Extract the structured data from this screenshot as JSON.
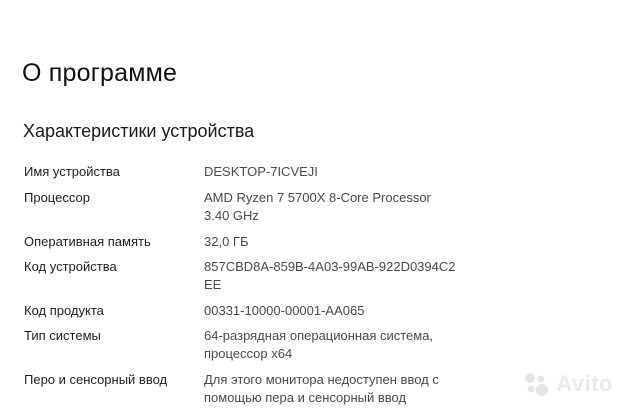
{
  "page": {
    "title": "О программе",
    "section_title": "Характеристики устройства"
  },
  "specs": [
    {
      "label": "Имя устройства",
      "value": [
        "DESKTOP-7ICVEJI"
      ]
    },
    {
      "label": "Процессор",
      "value": [
        "AMD Ryzen 7 5700X 8-Core Processor",
        "3.40 GHz"
      ]
    },
    {
      "label": "Оперативная память",
      "value": [
        "32,0 ГБ"
      ]
    },
    {
      "label": "Код устройства",
      "value": [
        "857CBD8A-859B-4A03-99AB-922D0394C2",
        "EE"
      ]
    },
    {
      "label": "Код продукта",
      "value": [
        "00331-10000-00001-AA065"
      ]
    },
    {
      "label": "Тип системы",
      "value": [
        "64-разрядная операционная система,",
        "процессор x64"
      ]
    },
    {
      "label": "Перо и сенсорный ввод",
      "value": [
        "Для этого монитора недоступен ввод с",
        "помощью пера и сенсорный ввод"
      ]
    }
  ],
  "watermark": {
    "text": "Avito",
    "icon": "avito-logo-icon"
  }
}
